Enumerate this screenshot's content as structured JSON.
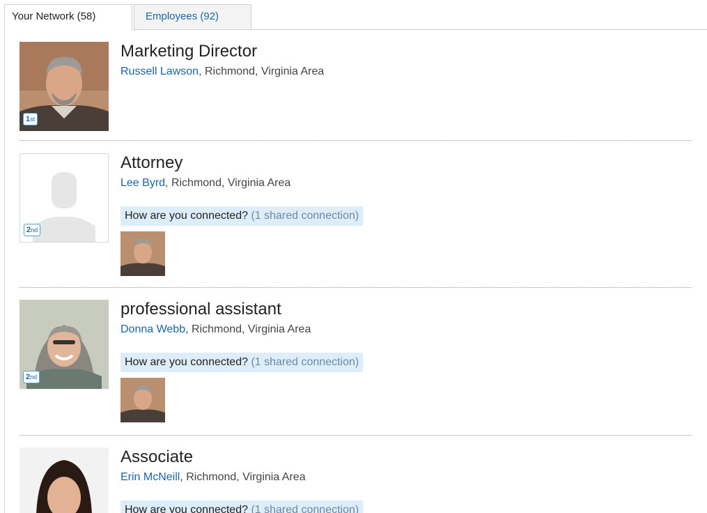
{
  "tabs": [
    {
      "label": "Your Network (58)"
    },
    {
      "label": "Employees (92)"
    }
  ],
  "people": [
    {
      "title": "Marketing Director",
      "name": "Russell Lawson",
      "location": ", Richmond, Virginia Area",
      "degree_num": "1",
      "degree_suffix": "st"
    },
    {
      "title": "Attorney",
      "name": "Lee Byrd",
      "location": ", Richmond, Virginia Area",
      "degree_num": "2",
      "degree_suffix": "nd",
      "connected_q": "How are you connected?",
      "shared": "(1 shared connection)"
    },
    {
      "title": "professional assistant",
      "name": "Donna Webb",
      "location": ", Richmond, Virginia Area",
      "degree_num": "2",
      "degree_suffix": "nd",
      "connected_q": "How are you connected?",
      "shared": "(1 shared connection)"
    },
    {
      "title": "Associate",
      "name": "Erin McNeill",
      "location": ", Richmond, Virginia Area",
      "connected_q": "How are you connected?",
      "shared": "(1 shared connection)"
    }
  ]
}
